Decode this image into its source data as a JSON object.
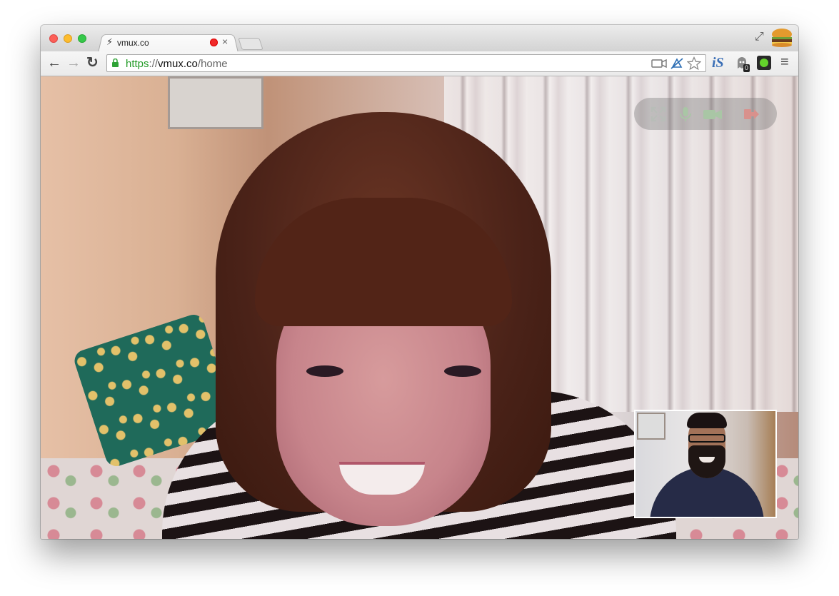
{
  "window": {
    "buttons": [
      "close",
      "minimize",
      "maximize"
    ]
  },
  "tab": {
    "title": "vmux.co",
    "icon": "bolt-icon",
    "recording": true,
    "close_label": "×"
  },
  "toolbar": {
    "back_label": "←",
    "forward_label": "→",
    "reload_label": "↻",
    "url": {
      "scheme": "https",
      "separator": "://",
      "host": "vmux.co",
      "path": "/home"
    },
    "extensions": {
      "is_label": "iS",
      "badge_count": "0"
    }
  },
  "call": {
    "controls": [
      "expand-icon",
      "microphone-icon",
      "camera-icon",
      "leave-call-icon"
    ],
    "control_color": "#a9c6a5",
    "leave_color": "#d9918c"
  },
  "colors": {
    "accent_green": "#219a25",
    "recording_red": "#f02a2a"
  }
}
